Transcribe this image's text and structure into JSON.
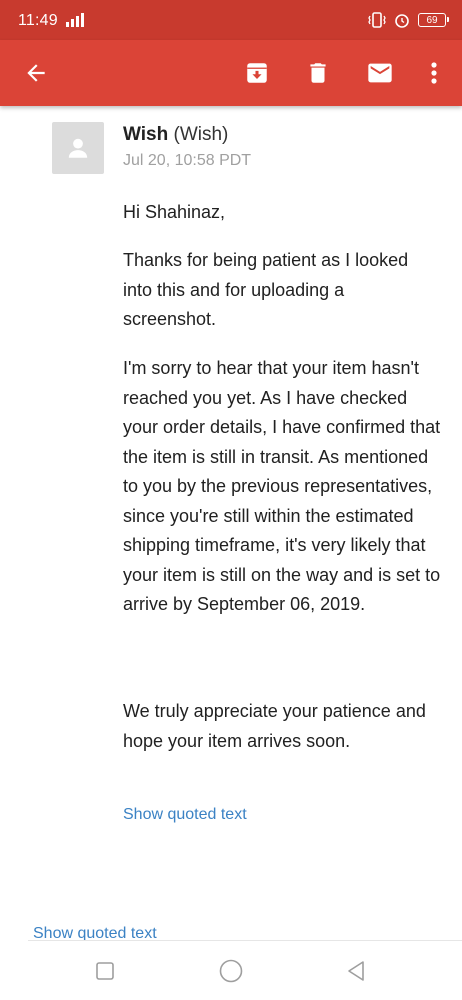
{
  "status_bar": {
    "time": "11:49",
    "battery": "69"
  },
  "app_bar": {
    "back_icon": "arrow-left-icon",
    "actions": [
      "archive-icon",
      "delete-icon",
      "mark-unread-icon",
      "more-vert-icon"
    ]
  },
  "message": {
    "sender_name": "Wish",
    "sender_email": "(Wish)",
    "date": "Jul 20, 10:58 PDT",
    "greeting": "Hi Shahinaz,",
    "paragraph_1": "Thanks for being patient as I looked into this and for uploading a screenshot.",
    "paragraph_2": "I'm sorry to hear that your item hasn't reached you yet. As I have checked your order details, I have confirmed that the item is still in transit. As mentioned to you by the previous representatives, since you're still within the estimated shipping timeframe, it's very likely that your item is still on the way and is set to arrive by September 06, 2019.",
    "paragraph_3": "We truly appreciate your patience and hope your item arrives soon.",
    "show_quoted_1": "Show quoted text",
    "show_quoted_2": "Show quoted text"
  },
  "nav_bar": {
    "icons": [
      "recents-square-icon",
      "home-circle-icon",
      "back-triangle-icon"
    ]
  },
  "colors": {
    "app_bar": "#db4437",
    "status_bar": "#c83a2e",
    "link": "#3b82c4"
  }
}
